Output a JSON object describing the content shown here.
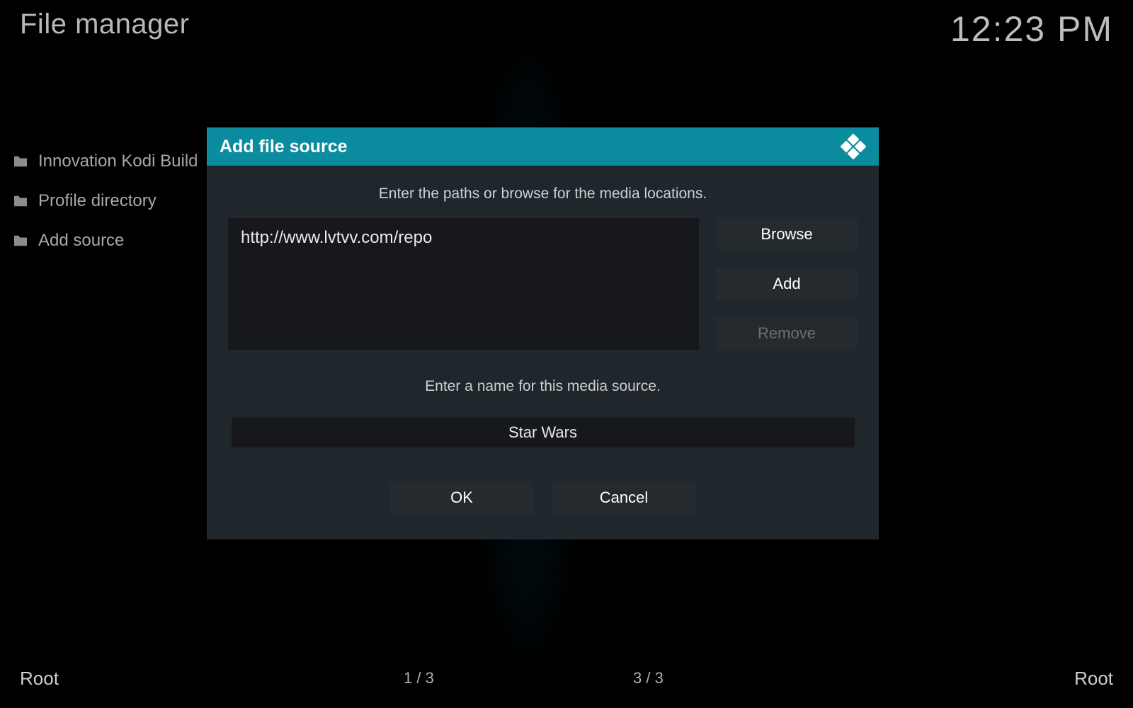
{
  "header": {
    "title": "File manager",
    "clock": "12:23 PM"
  },
  "sidebar": {
    "items": [
      {
        "label": "Innovation Kodi Build"
      },
      {
        "label": "Profile directory"
      },
      {
        "label": "Add source"
      }
    ]
  },
  "footer": {
    "left_label": "Root",
    "right_label": "Root",
    "count_left": "1 / 3",
    "count_right": "3 / 3"
  },
  "modal": {
    "title": "Add file source",
    "hint_paths": "Enter the paths or browse for the media locations.",
    "path_value": "http://www.lvtvv.com/repo",
    "browse_label": "Browse",
    "add_label": "Add",
    "remove_label": "Remove",
    "hint_name": "Enter a name for this media source.",
    "name_value": "Star Wars",
    "ok_label": "OK",
    "cancel_label": "Cancel"
  }
}
